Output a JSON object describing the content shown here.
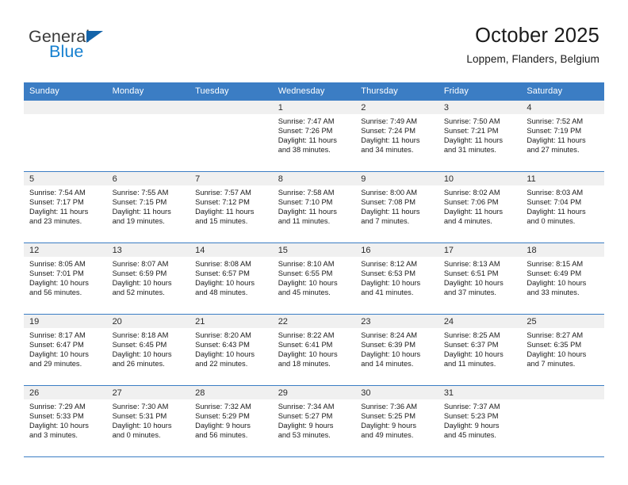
{
  "branding": {
    "name_part1": "General",
    "name_part2": "Blue"
  },
  "header": {
    "title": "October 2025",
    "subtitle": "Loppem, Flanders, Belgium"
  },
  "colors": {
    "header_blue": "#3b7dc4",
    "logo_blue": "#1580d0",
    "daynum_band": "#f0f0f0"
  },
  "weekday_headers": [
    "Sunday",
    "Monday",
    "Tuesday",
    "Wednesday",
    "Thursday",
    "Friday",
    "Saturday"
  ],
  "weeks": [
    [
      {
        "day": "",
        "lines": []
      },
      {
        "day": "",
        "lines": []
      },
      {
        "day": "",
        "lines": []
      },
      {
        "day": "1",
        "lines": [
          "Sunrise: 7:47 AM",
          "Sunset: 7:26 PM",
          "Daylight: 11 hours",
          "and 38 minutes."
        ]
      },
      {
        "day": "2",
        "lines": [
          "Sunrise: 7:49 AM",
          "Sunset: 7:24 PM",
          "Daylight: 11 hours",
          "and 34 minutes."
        ]
      },
      {
        "day": "3",
        "lines": [
          "Sunrise: 7:50 AM",
          "Sunset: 7:21 PM",
          "Daylight: 11 hours",
          "and 31 minutes."
        ]
      },
      {
        "day": "4",
        "lines": [
          "Sunrise: 7:52 AM",
          "Sunset: 7:19 PM",
          "Daylight: 11 hours",
          "and 27 minutes."
        ]
      }
    ],
    [
      {
        "day": "5",
        "lines": [
          "Sunrise: 7:54 AM",
          "Sunset: 7:17 PM",
          "Daylight: 11 hours",
          "and 23 minutes."
        ]
      },
      {
        "day": "6",
        "lines": [
          "Sunrise: 7:55 AM",
          "Sunset: 7:15 PM",
          "Daylight: 11 hours",
          "and 19 minutes."
        ]
      },
      {
        "day": "7",
        "lines": [
          "Sunrise: 7:57 AM",
          "Sunset: 7:12 PM",
          "Daylight: 11 hours",
          "and 15 minutes."
        ]
      },
      {
        "day": "8",
        "lines": [
          "Sunrise: 7:58 AM",
          "Sunset: 7:10 PM",
          "Daylight: 11 hours",
          "and 11 minutes."
        ]
      },
      {
        "day": "9",
        "lines": [
          "Sunrise: 8:00 AM",
          "Sunset: 7:08 PM",
          "Daylight: 11 hours",
          "and 7 minutes."
        ]
      },
      {
        "day": "10",
        "lines": [
          "Sunrise: 8:02 AM",
          "Sunset: 7:06 PM",
          "Daylight: 11 hours",
          "and 4 minutes."
        ]
      },
      {
        "day": "11",
        "lines": [
          "Sunrise: 8:03 AM",
          "Sunset: 7:04 PM",
          "Daylight: 11 hours",
          "and 0 minutes."
        ]
      }
    ],
    [
      {
        "day": "12",
        "lines": [
          "Sunrise: 8:05 AM",
          "Sunset: 7:01 PM",
          "Daylight: 10 hours",
          "and 56 minutes."
        ]
      },
      {
        "day": "13",
        "lines": [
          "Sunrise: 8:07 AM",
          "Sunset: 6:59 PM",
          "Daylight: 10 hours",
          "and 52 minutes."
        ]
      },
      {
        "day": "14",
        "lines": [
          "Sunrise: 8:08 AM",
          "Sunset: 6:57 PM",
          "Daylight: 10 hours",
          "and 48 minutes."
        ]
      },
      {
        "day": "15",
        "lines": [
          "Sunrise: 8:10 AM",
          "Sunset: 6:55 PM",
          "Daylight: 10 hours",
          "and 45 minutes."
        ]
      },
      {
        "day": "16",
        "lines": [
          "Sunrise: 8:12 AM",
          "Sunset: 6:53 PM",
          "Daylight: 10 hours",
          "and 41 minutes."
        ]
      },
      {
        "day": "17",
        "lines": [
          "Sunrise: 8:13 AM",
          "Sunset: 6:51 PM",
          "Daylight: 10 hours",
          "and 37 minutes."
        ]
      },
      {
        "day": "18",
        "lines": [
          "Sunrise: 8:15 AM",
          "Sunset: 6:49 PM",
          "Daylight: 10 hours",
          "and 33 minutes."
        ]
      }
    ],
    [
      {
        "day": "19",
        "lines": [
          "Sunrise: 8:17 AM",
          "Sunset: 6:47 PM",
          "Daylight: 10 hours",
          "and 29 minutes."
        ]
      },
      {
        "day": "20",
        "lines": [
          "Sunrise: 8:18 AM",
          "Sunset: 6:45 PM",
          "Daylight: 10 hours",
          "and 26 minutes."
        ]
      },
      {
        "day": "21",
        "lines": [
          "Sunrise: 8:20 AM",
          "Sunset: 6:43 PM",
          "Daylight: 10 hours",
          "and 22 minutes."
        ]
      },
      {
        "day": "22",
        "lines": [
          "Sunrise: 8:22 AM",
          "Sunset: 6:41 PM",
          "Daylight: 10 hours",
          "and 18 minutes."
        ]
      },
      {
        "day": "23",
        "lines": [
          "Sunrise: 8:24 AM",
          "Sunset: 6:39 PM",
          "Daylight: 10 hours",
          "and 14 minutes."
        ]
      },
      {
        "day": "24",
        "lines": [
          "Sunrise: 8:25 AM",
          "Sunset: 6:37 PM",
          "Daylight: 10 hours",
          "and 11 minutes."
        ]
      },
      {
        "day": "25",
        "lines": [
          "Sunrise: 8:27 AM",
          "Sunset: 6:35 PM",
          "Daylight: 10 hours",
          "and 7 minutes."
        ]
      }
    ],
    [
      {
        "day": "26",
        "lines": [
          "Sunrise: 7:29 AM",
          "Sunset: 5:33 PM",
          "Daylight: 10 hours",
          "and 3 minutes."
        ]
      },
      {
        "day": "27",
        "lines": [
          "Sunrise: 7:30 AM",
          "Sunset: 5:31 PM",
          "Daylight: 10 hours",
          "and 0 minutes."
        ]
      },
      {
        "day": "28",
        "lines": [
          "Sunrise: 7:32 AM",
          "Sunset: 5:29 PM",
          "Daylight: 9 hours",
          "and 56 minutes."
        ]
      },
      {
        "day": "29",
        "lines": [
          "Sunrise: 7:34 AM",
          "Sunset: 5:27 PM",
          "Daylight: 9 hours",
          "and 53 minutes."
        ]
      },
      {
        "day": "30",
        "lines": [
          "Sunrise: 7:36 AM",
          "Sunset: 5:25 PM",
          "Daylight: 9 hours",
          "and 49 minutes."
        ]
      },
      {
        "day": "31",
        "lines": [
          "Sunrise: 7:37 AM",
          "Sunset: 5:23 PM",
          "Daylight: 9 hours",
          "and 45 minutes."
        ]
      },
      {
        "day": "",
        "lines": []
      }
    ]
  ]
}
